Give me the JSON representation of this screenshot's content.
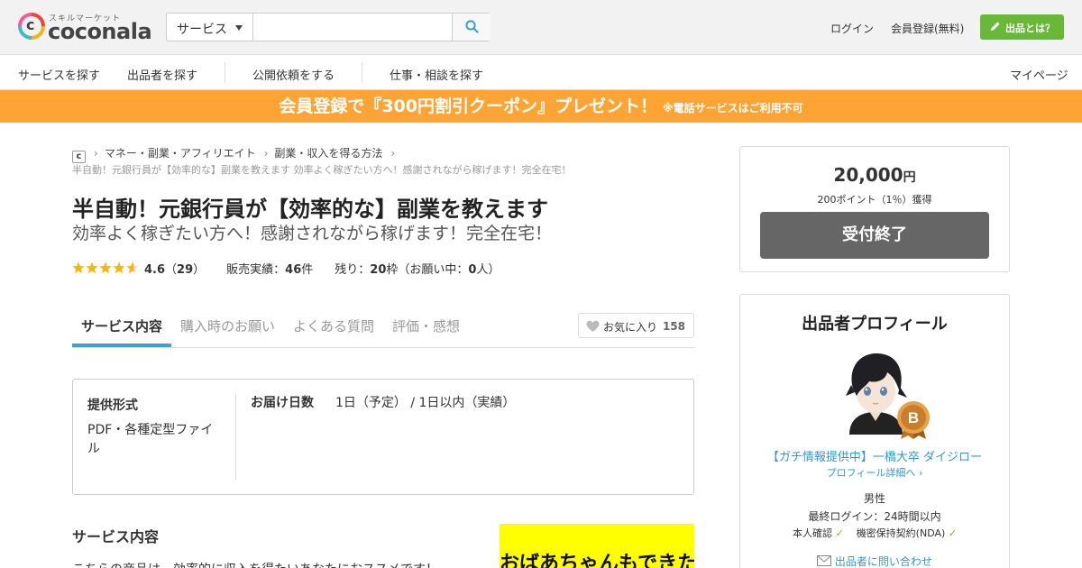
{
  "header": {
    "logo_sub": "スキルマーケット",
    "logo_word": "coconala",
    "search_category": "サービス",
    "search_placeholder": "",
    "login": "ログイン",
    "signup": "会員登録(無料)",
    "listing_button": "出品とは？"
  },
  "nav": {
    "items": [
      "サービスを探す",
      "出品者を探す",
      "公開依頼をする",
      "仕事・相談を探す"
    ],
    "mypage": "マイページ"
  },
  "banner": {
    "main": "会員登録で『300円割引クーポン』プレゼント！",
    "note": "※電話サービスはご利用不可"
  },
  "breadcrumb": {
    "items": [
      "マネー・副業・アフィリエイト",
      "副業・収入を得る方法"
    ],
    "current": "半自動！元銀行員が【効率的な】副業を教えます 効率よく稼ぎたい方へ！感謝されながら稼げます！完全在宅！"
  },
  "service": {
    "title": "半自動！元銀行員が【効率的な】副業を教えます",
    "subtitle": "効率よく稼ぎたい方へ！感謝されながら稼げます！完全在宅！",
    "rating": 4.6,
    "rating_text": "4.6",
    "review_count": "29",
    "sales_label": "販売実績：",
    "sales_value": "46",
    "sales_unit": "件",
    "remaining_label": "残り：",
    "remaining_value": "20",
    "remaining_unit": "枠（お願い中：",
    "in_progress_value": "0",
    "in_progress_unit": "人）"
  },
  "tabs": {
    "items": [
      "サービス内容",
      "購入時のお願い",
      "よくある質問",
      "評価・感想"
    ],
    "favorite_label": "お気に入り",
    "favorite_count": "158"
  },
  "spec": {
    "format_label": "提供形式",
    "format_value": "PDF・各種定型ファイル",
    "delivery_label": "お届け日数",
    "delivery_value": "1日（予定） / 1日以内（実績）"
  },
  "content": {
    "section_title": "サービス内容",
    "text": "こちらの商品は、効率的に収入を得たいあなたにおススメです！",
    "image_text": "おばあちゃんもできた"
  },
  "purchase": {
    "price": "20,000",
    "price_unit": "円",
    "points": "200ポイント（1％）獲得",
    "status_button": "受付終了"
  },
  "profile": {
    "heading": "出品者プロフィール",
    "badge_letter": "B",
    "name": "【ガチ情報提供中】一橋大卒 ダイジロー",
    "detail_link": "プロフィール詳細へ",
    "gender": "男性",
    "last_login": "最終ログイン：24時間以内",
    "identity": "本人確認",
    "nda": "機密保持契約(NDA)",
    "contact": "出品者に問い合わせ"
  },
  "colors": {
    "accent_green": "#6ab838",
    "banner_orange": "#fda435",
    "link_blue": "#2e9ad0",
    "tab_blue": "#3aa0d8",
    "star_gold": "#f5b800"
  }
}
